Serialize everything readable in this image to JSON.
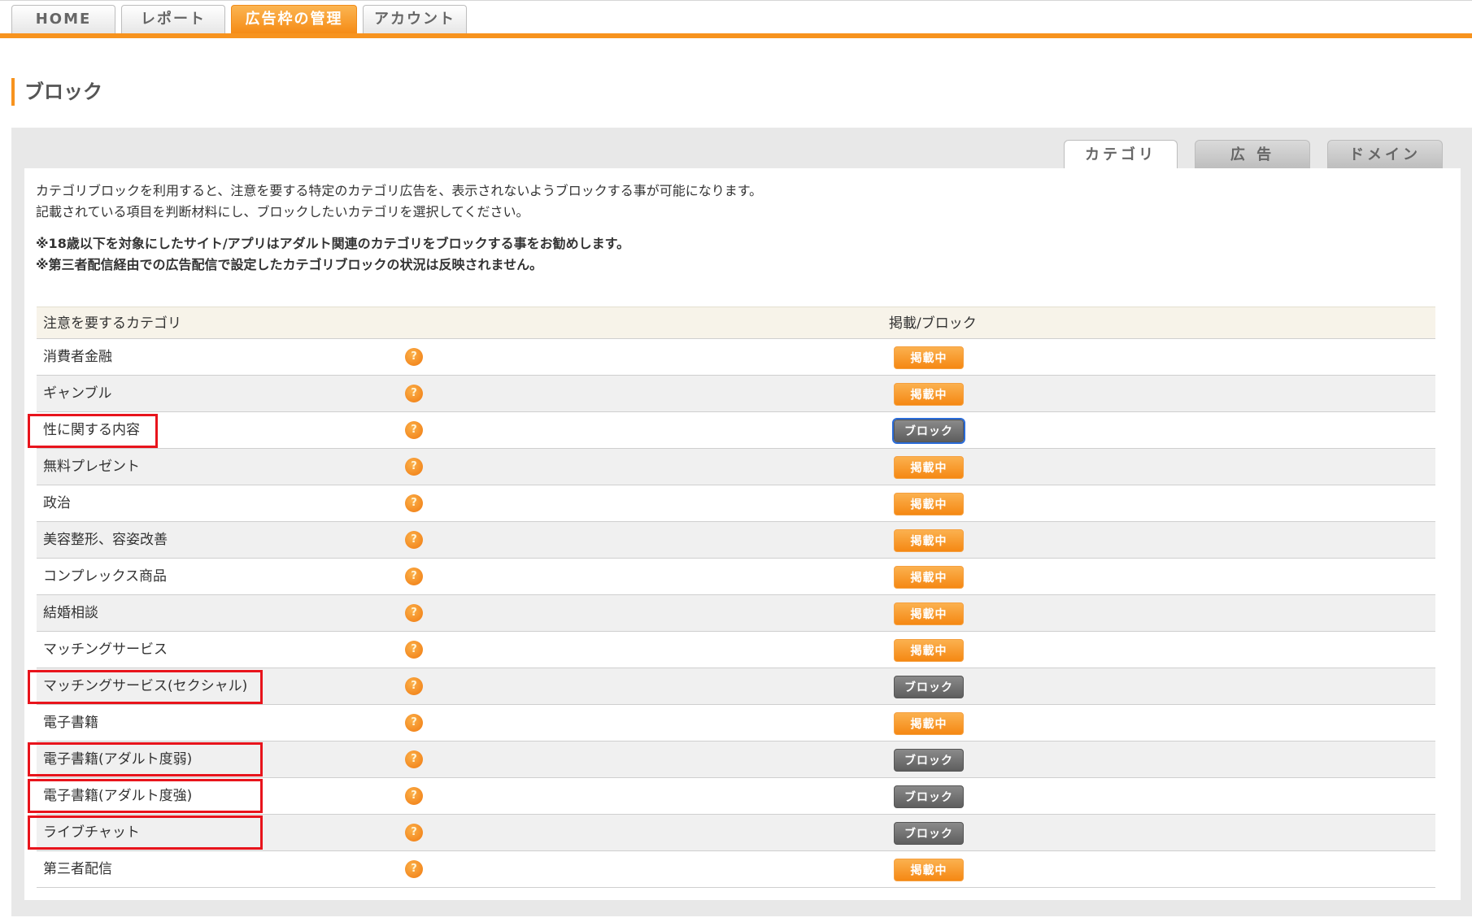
{
  "nav": {
    "tabs": [
      {
        "label": "HOME",
        "active": false
      },
      {
        "label": "レポート",
        "active": false
      },
      {
        "label": "広告枠の管理",
        "active": true
      },
      {
        "label": "アカウント",
        "active": false
      }
    ]
  },
  "page": {
    "title": "ブロック"
  },
  "subtabs": [
    {
      "label": "カテゴリ",
      "active": true
    },
    {
      "label": "広 告",
      "active": false
    },
    {
      "label": "ドメイン",
      "active": false
    }
  ],
  "description": {
    "line1": "カテゴリブロックを利用すると、注意を要する特定のカテゴリ広告を、表示されないようブロックする事が可能になります。",
    "line2": "記載されている項目を判断材料にし、ブロックしたいカテゴリを選択してください。",
    "note1": "※18歳以下を対象にしたサイト/アプリはアダルト関連のカテゴリをブロックする事をお勧めします。",
    "note2": "※第三者配信経由での広告配信で設定したカテゴリブロックの状況は反映されません。"
  },
  "table": {
    "header_category": "注意を要するカテゴリ",
    "header_status": "掲載/ブロック",
    "help_glyph": "?",
    "rows": [
      {
        "category": "消費者金融",
        "status": "掲載中",
        "blocked": false
      },
      {
        "category": "ギャンブル",
        "status": "掲載中",
        "blocked": false
      },
      {
        "category": "性に関する内容",
        "status": "ブロック",
        "blocked": true
      },
      {
        "category": "無料プレゼント",
        "status": "掲載中",
        "blocked": false
      },
      {
        "category": "政治",
        "status": "掲載中",
        "blocked": false
      },
      {
        "category": "美容整形、容姿改善",
        "status": "掲載中",
        "blocked": false
      },
      {
        "category": "コンプレックス商品",
        "status": "掲載中",
        "blocked": false
      },
      {
        "category": "結婚相談",
        "status": "掲載中",
        "blocked": false
      },
      {
        "category": "マッチングサービス",
        "status": "掲載中",
        "blocked": false
      },
      {
        "category": "マッチングサービス(セクシャル)",
        "status": "ブロック",
        "blocked": true
      },
      {
        "category": "電子書籍",
        "status": "掲載中",
        "blocked": false
      },
      {
        "category": "電子書籍(アダルト度弱)",
        "status": "ブロック",
        "blocked": true
      },
      {
        "category": "電子書籍(アダルト度強)",
        "status": "ブロック",
        "blocked": true
      },
      {
        "category": "ライブチャット",
        "status": "ブロック",
        "blocked": true
      },
      {
        "category": "第三者配信",
        "status": "掲載中",
        "blocked": false
      }
    ]
  },
  "colors": {
    "accent": "#f7931e",
    "highlight": "#e8141c",
    "blocked": "#6b6b6b"
  }
}
